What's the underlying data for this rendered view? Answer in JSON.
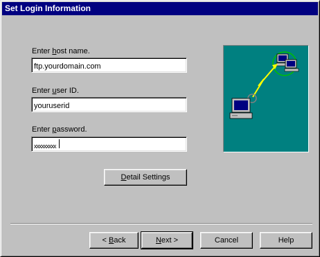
{
  "window": {
    "title": "Set Login Information"
  },
  "form": {
    "host": {
      "label_pre": "Enter ",
      "label_key": "h",
      "label_post": "ost name.",
      "value": "ftp.yourdomain.com"
    },
    "user": {
      "label_pre": "Enter ",
      "label_key": "u",
      "label_post": "ser ID.",
      "value": "youruserid"
    },
    "password": {
      "label_pre": "Enter ",
      "label_key": "p",
      "label_post": "assword.",
      "value": "xxxxxxxxx"
    }
  },
  "buttons": {
    "detail": {
      "key": "D",
      "rest": "etail Settings"
    },
    "back": {
      "pre": "< ",
      "key": "B",
      "rest": "ack"
    },
    "next": {
      "key": "N",
      "rest": "ext >"
    },
    "cancel": "Cancel",
    "help": "Help"
  },
  "illustration": {
    "background": "#008080",
    "icons": [
      "local-computer-icon",
      "remote-server-icon",
      "connection-lightning-icon"
    ]
  }
}
